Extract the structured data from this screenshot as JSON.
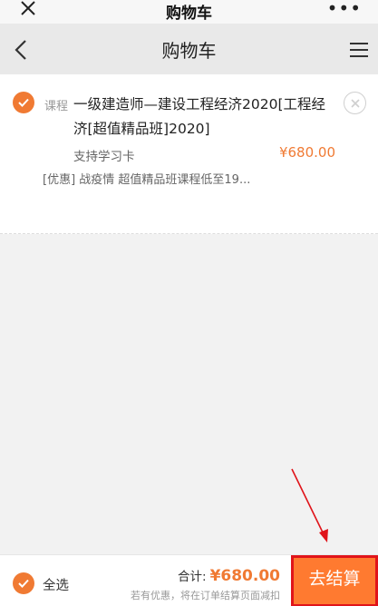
{
  "top_bar": {
    "title": "购物车",
    "more_symbol": "•••"
  },
  "nav_bar": {
    "title": "购物车"
  },
  "cart_item": {
    "tag": "课程",
    "title": "一级建造师—建设工程经济2020[工程经济[超值精品班]2020]",
    "support": "支持学习卡",
    "price": "¥680.00",
    "promo": "[优惠] 战疫情 超值精品班课程低至19..."
  },
  "footer": {
    "select_all_label": "全选",
    "total_label": "合计:",
    "total_value": "¥680.00",
    "hint": "若有优惠，将在订单结算页面减扣",
    "checkout_label": "去结算"
  },
  "colors": {
    "accent": "#f07a33",
    "checkout_bg": "#ff7a30",
    "highlight_border": "#e0141a"
  }
}
